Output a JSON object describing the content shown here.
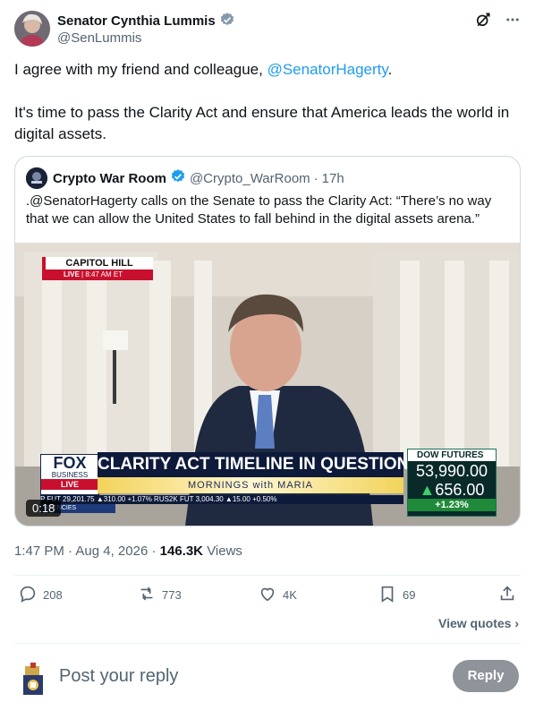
{
  "author": {
    "name": "Senator Cynthia Lummis",
    "handle": "@SenLummis"
  },
  "tweet": {
    "line1_prefix": "I agree with my friend and colleague, ",
    "line1_mention": "@SenatorHagerty",
    "line1_suffix": ".",
    "paragraph2": "It's time to pass the Clarity Act and ensure that America leads the world in digital assets."
  },
  "quoted": {
    "name": "Crypto War Room",
    "handle": "@Crypto_WarRoom",
    "time": "17h",
    "text": ".@SenatorHagerty calls on the Senate to pass the Clarity Act: “There’s no way that we can allow the United States to fall behind in the digital assets arena.”",
    "video": {
      "duration": "0:18",
      "location": "CAPITOL HILL",
      "live": "LIVE",
      "live_time": "8:47 AM ET",
      "network": "FOX",
      "network_sub": "BUSINESS",
      "network_live": "LIVE",
      "headline": "CLARITY ACT TIMELINE IN QUESTION",
      "show": "MORNINGS with MARIA",
      "ticker": "P FUT  29,201.75 ▲310.00 +1.07%  RUS2K FUT  3,004.30 ▲15.00 +0.50%",
      "ticker_left": "RRENCIES",
      "dow_label": "DOW FUTURES",
      "dow_value": "53,990.00",
      "dow_change": "656.00",
      "dow_pct": "+1.23%"
    }
  },
  "meta": {
    "time": "1:47 PM",
    "date": "Aug 4, 2026",
    "views": "146.3K",
    "views_label": "Views"
  },
  "actions": {
    "replies": "208",
    "reposts": "773",
    "likes": "4K",
    "bookmarks": "69"
  },
  "view_quotes": "View quotes",
  "reply": {
    "placeholder": "Post your reply",
    "button": "Reply"
  },
  "colors": {
    "link": "#1d9bf0",
    "verified": "#1d9bf0",
    "muted": "#536471"
  }
}
